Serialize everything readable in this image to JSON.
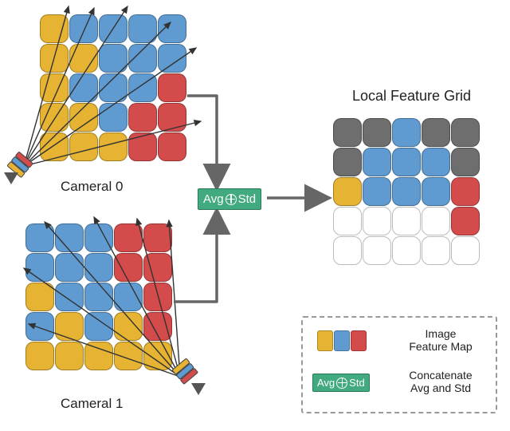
{
  "palette": {
    "yellow": "#e6b332",
    "blue": "#5f9bd1",
    "red": "#d34b4b",
    "gray": "#6e6e6e",
    "white": "#ffffff",
    "green": "#42aa7f"
  },
  "labels": {
    "camera0": "Cameral 0",
    "camera1": "Cameral 1",
    "local_grid_title": "Local Feature Grid",
    "op_label": "Avg⊕Std",
    "legend_featuremap": "Image\nFeature Map",
    "legend_concat": "Concatenate\nAvg and Std"
  },
  "diagram": {
    "grid_size": [
      5,
      5
    ],
    "camera0_grid": [
      [
        "Y",
        "B",
        "B",
        "B",
        "B"
      ],
      [
        "Y",
        "Y",
        "B",
        "B",
        "B"
      ],
      [
        "Y",
        "B",
        "B",
        "B",
        "R"
      ],
      [
        "Y",
        "Y",
        "B",
        "R",
        "R"
      ],
      [
        "Y",
        "Y",
        "Y",
        "R",
        "R"
      ]
    ],
    "camera1_grid": [
      [
        "B",
        "B",
        "B",
        "R",
        "R"
      ],
      [
        "B",
        "B",
        "B",
        "R",
        "R"
      ],
      [
        "Y",
        "B",
        "B",
        "B",
        "R"
      ],
      [
        "B",
        "Y",
        "B",
        "Y",
        "R"
      ],
      [
        "Y",
        "Y",
        "Y",
        "Y",
        "Y"
      ]
    ],
    "output_grid": [
      [
        "G",
        "G",
        "B",
        "G",
        "G"
      ],
      [
        "G",
        "B",
        "B",
        "B",
        "G"
      ],
      [
        "Y",
        "B",
        "B",
        "B",
        "R"
      ],
      [
        "W",
        "W",
        "W",
        "W",
        "R"
      ],
      [
        "W",
        "W",
        "W",
        "W",
        "W"
      ]
    ]
  },
  "chart_data": {
    "type": "diagram",
    "description": "Two 5x5 image feature maps (Camera 0 and Camera 1) are projected via camera rays and aggregated by concatenating per-cell Avg and Std into a 5x5 Local Feature Grid.",
    "color_legend": {
      "Y": "yellow",
      "B": "blue",
      "R": "red",
      "G": "gray",
      "W": "white"
    },
    "operation": "concat(Avg, Std)"
  },
  "legend": {
    "swatches": [
      "Y",
      "B",
      "R"
    ],
    "op_swatch_label": "Avg⊕Std"
  }
}
